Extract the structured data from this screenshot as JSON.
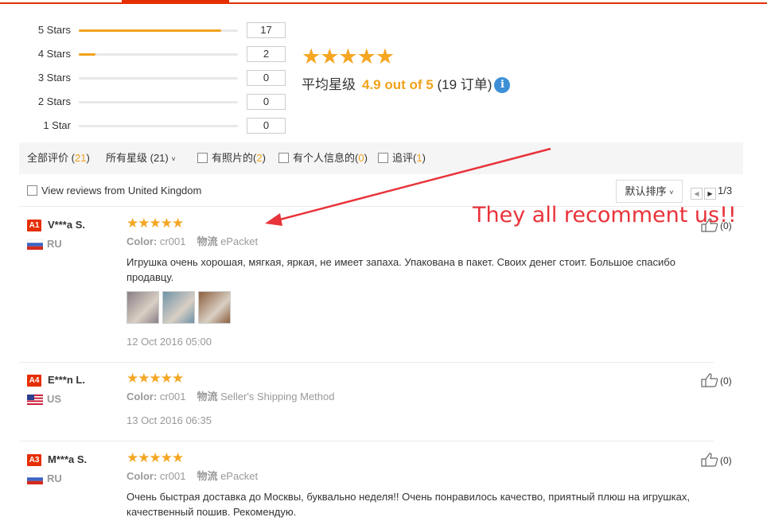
{
  "histogram": [
    {
      "label": "5 Stars",
      "count": "17",
      "fraction": 0.895
    },
    {
      "label": "4 Stars",
      "count": "2",
      "fraction": 0.105
    },
    {
      "label": "3 Stars",
      "count": "0",
      "fraction": 0
    },
    {
      "label": "2 Stars",
      "count": "0",
      "fraction": 0
    },
    {
      "label": "1 Star",
      "count": "0",
      "fraction": 0
    }
  ],
  "summary": {
    "stars": "★★★★★",
    "avg_label": "平均星级",
    "avg_score": "4.9 out of 5",
    "orders": "(19 订单)",
    "info_icon": "i"
  },
  "filters": {
    "all_label": "全部评价",
    "all_count": "21",
    "star_select": "所有星级 (21)",
    "photo_label": "有照片的",
    "photo_count": "2",
    "personal_label": "有个人信息的",
    "personal_count": "0",
    "followup_label": "追评",
    "followup_count": "1",
    "uk_label": "View reviews from United Kingdom",
    "sort_label": "默认排序",
    "page": "1/3"
  },
  "annotation": "They all recomment us!!",
  "reviews": [
    {
      "badge": "A1",
      "user": "V***a S.",
      "country": "RU",
      "flag": "russia-flag",
      "stars": "★★★★★",
      "color_label": "Color:",
      "color_value": "cr001",
      "shipping_label": "物流",
      "shipping_value": "ePacket",
      "text": "Игрушка очень хорошая, мягкая, яркая, не имеет запаха. Упакована в пакет. Своих денег стоит. Большое спасибо продавцу.",
      "photos": [
        "#8a7f86",
        "#6f93a8",
        "#8c5f3d"
      ],
      "date": "12 Oct 2016 05:00",
      "helpful": "(0)"
    },
    {
      "badge": "A4",
      "user": "E***n L.",
      "country": "US",
      "flag": "usa-flag",
      "stars": "★★★★★",
      "color_label": "Color:",
      "color_value": "cr001",
      "shipping_label": "物流",
      "shipping_value": "Seller's Shipping Method",
      "date": "13 Oct 2016 06:35",
      "helpful": "(0)"
    },
    {
      "badge": "A3",
      "user": "M***a S.",
      "country": "RU",
      "flag": "russia-flag",
      "stars": "★★★★★",
      "color_label": "Color:",
      "color_value": "cr001",
      "shipping_label": "物流",
      "shipping_value": "ePacket",
      "text": "Очень быстрая доставка до Москвы, буквально неделя!! Очень понравилось качество, приятный плюш на игрушках, качественный пошив. Рекомендую.",
      "helpful": "(0)"
    }
  ],
  "colors": {
    "accent": "#e62e04",
    "star": "#f5a623",
    "score": "#f0a21b",
    "annotation": "#e8333a",
    "info": "#3d8fd6"
  }
}
